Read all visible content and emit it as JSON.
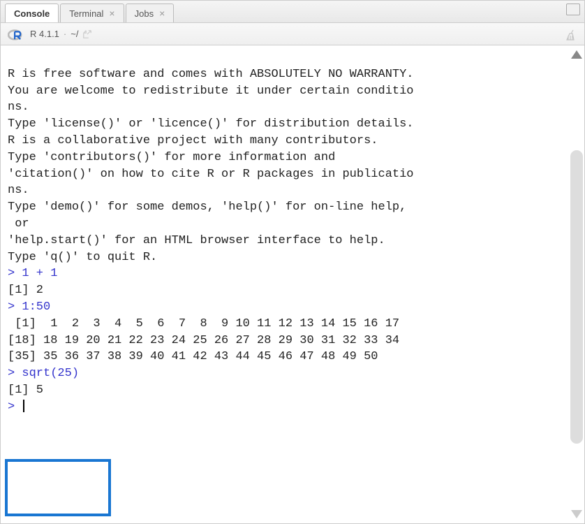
{
  "tabs": [
    {
      "label": "Console",
      "active": true,
      "closable": false
    },
    {
      "label": "Terminal",
      "active": false,
      "closable": true
    },
    {
      "label": "Jobs",
      "active": false,
      "closable": true
    }
  ],
  "toolbar": {
    "version": "R 4.1.1",
    "separator": "·",
    "path": "~/"
  },
  "console": {
    "lines": [
      {
        "type": "output",
        "text": "                                                        "
      },
      {
        "type": "output",
        "text": ""
      },
      {
        "type": "output",
        "text": "R is free software and comes with ABSOLUTELY NO WARRANTY."
      },
      {
        "type": "output",
        "text": "You are welcome to redistribute it under certain conditio"
      },
      {
        "type": "output",
        "text": "ns."
      },
      {
        "type": "output",
        "text": "Type 'license()' or 'licence()' for distribution details."
      },
      {
        "type": "output",
        "text": ""
      },
      {
        "type": "output",
        "text": "R is a collaborative project with many contributors."
      },
      {
        "type": "output",
        "text": "Type 'contributors()' for more information and"
      },
      {
        "type": "output",
        "text": "'citation()' on how to cite R or R packages in publicatio"
      },
      {
        "type": "output",
        "text": "ns."
      },
      {
        "type": "output",
        "text": ""
      },
      {
        "type": "output",
        "text": "Type 'demo()' for some demos, 'help()' for on-line help,"
      },
      {
        "type": "output",
        "text": " or"
      },
      {
        "type": "output",
        "text": "'help.start()' for an HTML browser interface to help."
      },
      {
        "type": "output",
        "text": "Type 'q()' to quit R."
      },
      {
        "type": "output",
        "text": ""
      },
      {
        "type": "input",
        "prompt": "> ",
        "text": "1 + 1"
      },
      {
        "type": "output",
        "text": "[1] 2"
      },
      {
        "type": "input",
        "prompt": "> ",
        "text": "1:50"
      },
      {
        "type": "output",
        "text": " [1]  1  2  3  4  5  6  7  8  9 10 11 12 13 14 15 16 17"
      },
      {
        "type": "output",
        "text": "[18] 18 19 20 21 22 23 24 25 26 27 28 29 30 31 32 33 34"
      },
      {
        "type": "output",
        "text": "[35] 35 36 37 38 39 40 41 42 43 44 45 46 47 48 49 50"
      },
      {
        "type": "input",
        "prompt": "> ",
        "text": "sqrt(25)"
      },
      {
        "type": "output",
        "text": "[1] 5"
      },
      {
        "type": "input",
        "prompt": "> ",
        "text": "",
        "cursor": true
      }
    ]
  }
}
